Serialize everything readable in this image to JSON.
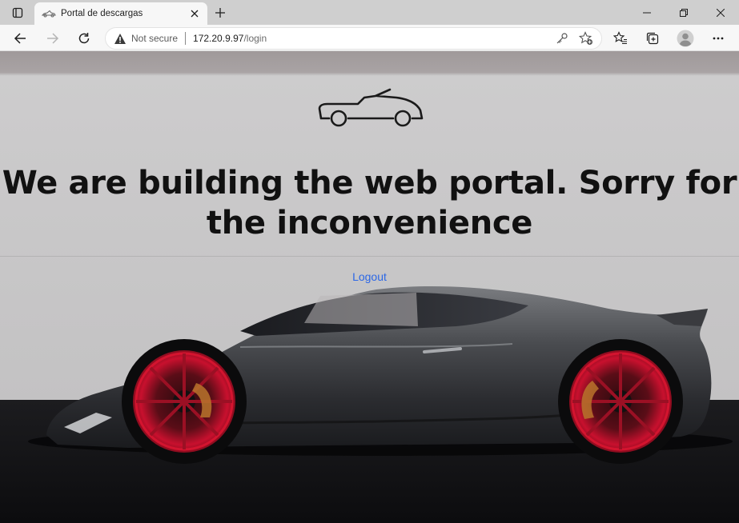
{
  "browser": {
    "tab": {
      "title": "Portal de descargas"
    },
    "omnibox": {
      "security_label": "Not secure",
      "url_host": "172.20.9.97",
      "url_path": "/login"
    }
  },
  "page": {
    "headline": "We are building the web portal. Sorry for the inconvenience",
    "logout_label": "Logout",
    "colors": {
      "link": "#2b67e6",
      "text": "#111111",
      "wall": "#c9c8c9",
      "ground": "#141416",
      "rim": "#c8102e"
    }
  }
}
